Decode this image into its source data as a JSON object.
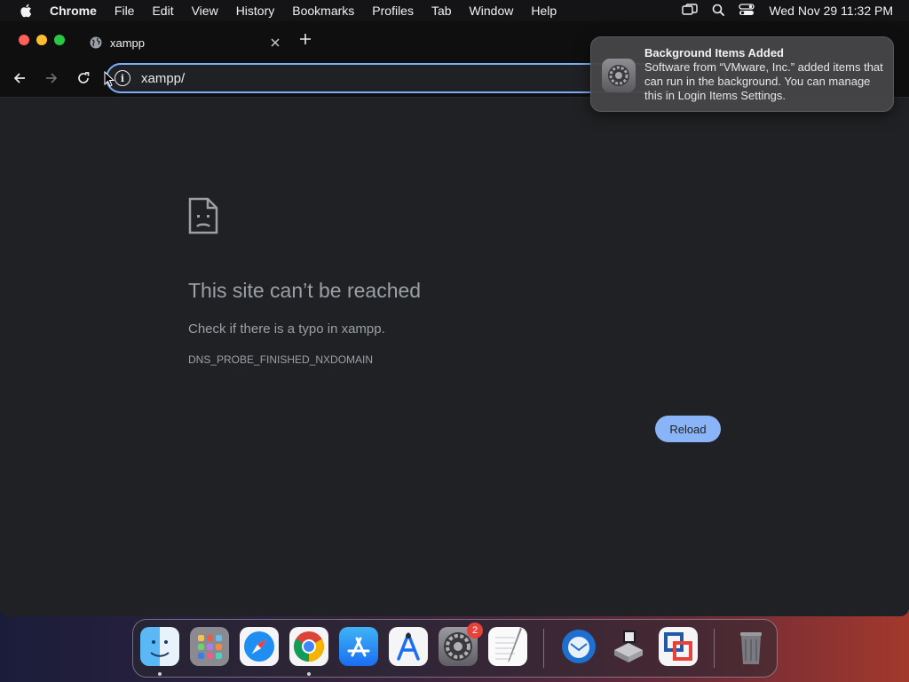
{
  "menubar": {
    "app_name": "Chrome",
    "items": [
      "File",
      "Edit",
      "View",
      "History",
      "Bookmarks",
      "Profiles",
      "Tab",
      "Window",
      "Help"
    ],
    "clock": "Wed Nov 29  11:32 PM"
  },
  "browser": {
    "tab_title": "xampp",
    "omnibox_value": "xampp/"
  },
  "error_page": {
    "title": "This site can’t be reached",
    "message": "Check if there is a typo in xampp.",
    "code": "DNS_PROBE_FINISHED_NXDOMAIN",
    "reload_label": "Reload"
  },
  "notification": {
    "title": "Background Items Added",
    "body": "Software from “VMware, Inc.” added items that can run in the background. You can manage this in Login Items Settings."
  },
  "dock": {
    "apps": [
      "Finder",
      "Launchpad",
      "Safari",
      "Chrome",
      "App Store",
      "Xcode Instruments",
      "System Settings",
      "TextEdit",
      "Thunderbird",
      "Boot Camp",
      "VMware Fusion",
      "Trash"
    ],
    "system_settings_badge": "2"
  },
  "colors": {
    "accent": "#8ab4f8",
    "page_bg": "#202124",
    "text_muted": "#9aa0a6"
  }
}
